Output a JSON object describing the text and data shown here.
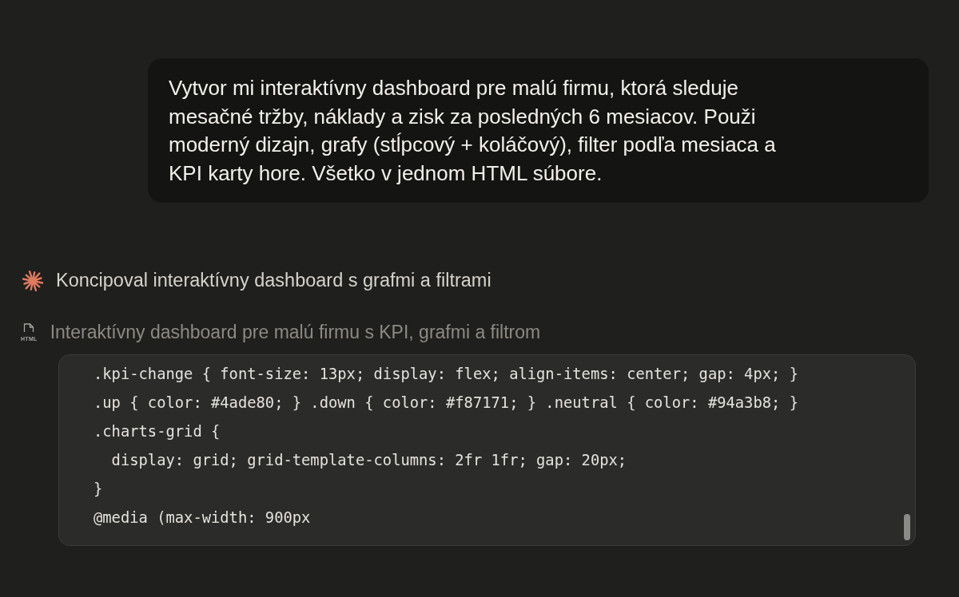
{
  "user_message": {
    "text": "Vytvor mi interaktívny dashboard pre malú firmu, ktorá sleduje mesačné tržby, náklady a zisk za posledných 6 mesiacov. Použi moderný dizajn, grafy (stĺpcový + koláčový), filter podľa mesiaca a KPI karty hore. Všetko v jednom HTML súbore."
  },
  "thinking_status": {
    "text": "Koncipoval interaktívny dashboard s grafmi a filtrami"
  },
  "artifact": {
    "icon_label": "HTML",
    "title": "Interaktívny dashboard pre malú firmu s KPI, grafmi a filtrom",
    "code_lines": [
      ".kpi-change { font-size: 13px; display: flex; align-items: center; gap: 4px; }",
      ".up { color: #4ade80; } .down { color: #f87171; } .neutral { color: #94a3b8; }",
      ".charts-grid {",
      "  display: grid; grid-template-columns: 2fr 1fr; gap: 20px;",
      "}",
      "@media (max-width: 900px"
    ]
  }
}
